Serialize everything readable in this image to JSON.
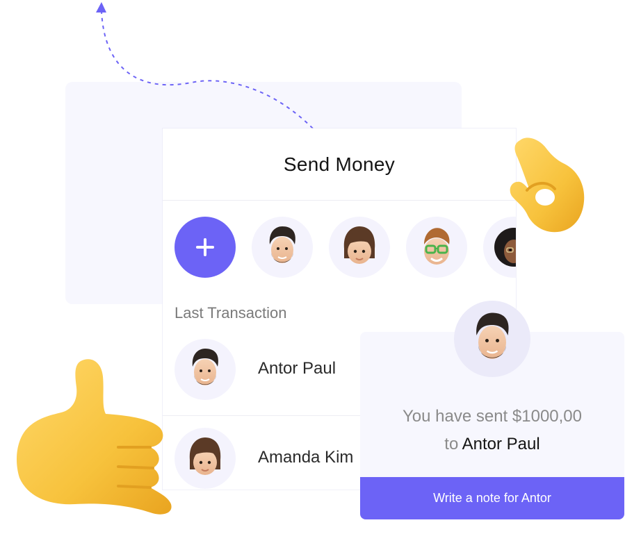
{
  "send_money": {
    "title": "Send Money",
    "add_contact_icon": "plus-icon",
    "contacts": [
      {
        "avatar": "man-beard-avatar"
      },
      {
        "avatar": "girl-bangs-avatar"
      },
      {
        "avatar": "man-glasses-avatar"
      },
      {
        "avatar": "woman-curly-avatar"
      }
    ],
    "last_transaction_label": "Last Transaction",
    "transactions": [
      {
        "name": "Antor Paul",
        "avatar": "man-beard-avatar"
      },
      {
        "name": "Amanda Kim",
        "avatar": "girl-bangs-avatar"
      }
    ]
  },
  "confirmation": {
    "sent_text": "You have sent $1000,00",
    "to_prefix": "to",
    "recipient": "Antor Paul",
    "note_button": "Write a note for Antor"
  },
  "colors": {
    "accent": "#6c63f6",
    "panel_bg": "#f7f7fe",
    "avatar_bg": "#f4f3fd",
    "emoji_yellow": "#f7c23c"
  },
  "decorations": {
    "arrow": "dashed-arrow-up-icon",
    "ok_hand": "ok-hand-emoji",
    "call_me_hand": "call-me-hand-emoji"
  }
}
